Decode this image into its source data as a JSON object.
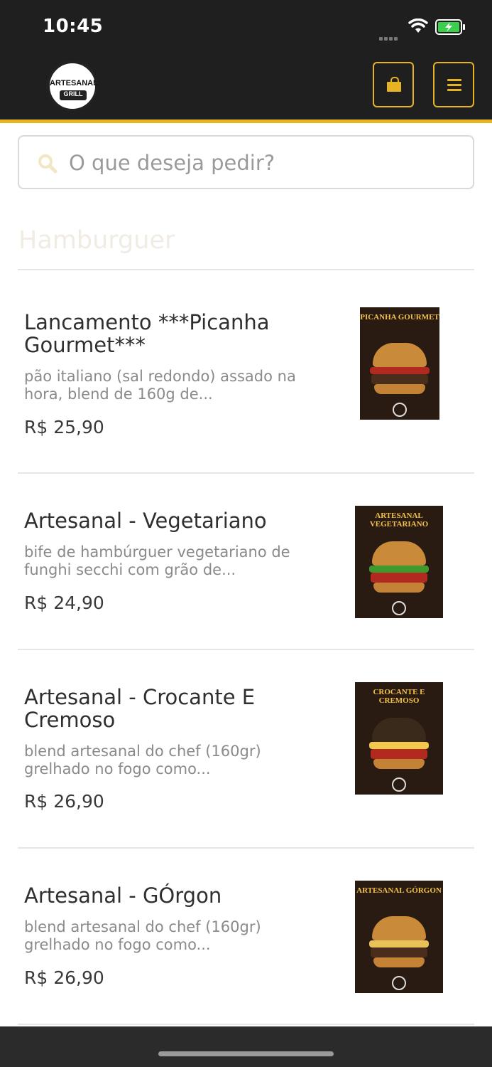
{
  "status_bar": {
    "time": "10:45"
  },
  "header": {
    "logo_line1": "ARTESANAL",
    "logo_line2": "GRILL"
  },
  "search": {
    "placeholder": "O que deseja pedir?"
  },
  "section": {
    "title": "Hamburguer"
  },
  "items": [
    {
      "name": "Lancamento ***Picanha Gourmet***",
      "description": "pão italiano (sal redondo) assado na hora, blend de 160g de...",
      "price": "R$ 25,90",
      "image_label": "PICANHA GOURMET"
    },
    {
      "name": "Artesanal - Vegetariano",
      "description": "bife de hambúrguer vegetariano de funghi secchi com grão de...",
      "price": "R$ 24,90",
      "image_label": "ARTESANAL VEGETARIANO"
    },
    {
      "name": "Artesanal - Crocante E Cremoso",
      "description": "blend artesanal do chef (160gr) grelhado no fogo como...",
      "price": "R$ 26,90",
      "image_label": "CROCANTE E CREMOSO"
    },
    {
      "name": "Artesanal - GÓrgon",
      "description": "blend artesanal do chef (160gr) grelhado no fogo como...",
      "price": "R$ 26,90",
      "image_label": "ARTESANAL GÓRGON"
    }
  ],
  "colors": {
    "accent": "#e6b325",
    "header_bg": "#1f1f1f"
  }
}
